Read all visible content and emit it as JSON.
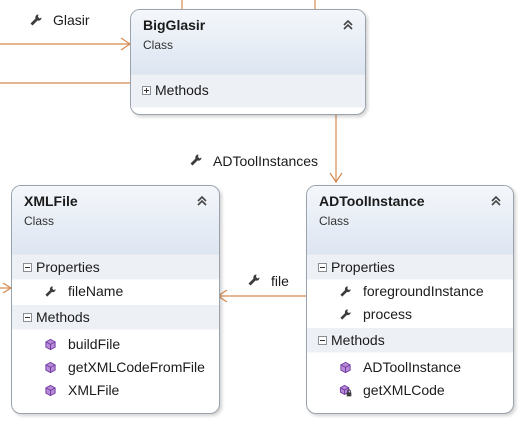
{
  "classes": {
    "bigglasir": {
      "name": "BigGlasir",
      "stereotype": "Class",
      "methods_label": "Methods"
    },
    "xmlfile": {
      "name": "XMLFile",
      "stereotype": "Class",
      "properties_label": "Properties",
      "properties": [
        "fileName"
      ],
      "methods_label": "Methods",
      "methods": [
        "buildFile",
        "getXMLCodeFromFile",
        "XMLFile"
      ]
    },
    "adtoolinstance": {
      "name": "ADToolInstance",
      "stereotype": "Class",
      "properties_label": "Properties",
      "properties": [
        "foregroundInstance",
        "process"
      ],
      "methods_label": "Methods",
      "methods": [
        "ADToolInstance",
        "getXMLCode"
      ]
    }
  },
  "associations": {
    "glasir": "Glasir",
    "adtoolinstances": "ADToolInstances",
    "file": "file"
  },
  "icons": {
    "association": "wrench-icon",
    "property": "wrench-icon",
    "method": "cube-method-icon",
    "private_method": "locked-method-icon",
    "collapse": "double-chevron-up-icon"
  },
  "colors": {
    "header_gradient_top": "#f4f7fb",
    "header_gradient_bottom": "#dde5f1",
    "section_bg": "#edf0f5",
    "connector": "#d58a52",
    "method_icon": "#8a4db8"
  }
}
